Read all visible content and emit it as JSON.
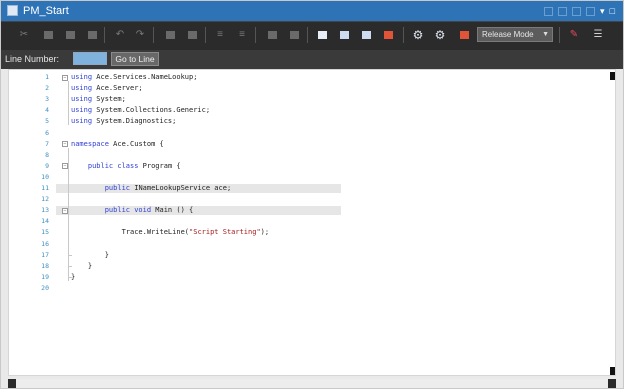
{
  "window": {
    "title": "PM_Start"
  },
  "toolbar": {
    "build_mode": "Release Mode"
  },
  "line_bar": {
    "label": "Line Number:",
    "input_value": "",
    "go_label": "Go to Line"
  },
  "editor": {
    "line_numbers": [
      "1",
      "2",
      "3",
      "4",
      "5",
      "6",
      "7",
      "8",
      "9",
      "10",
      "11",
      "12",
      "13",
      "14",
      "15",
      "16",
      "17",
      "18",
      "19",
      "20"
    ],
    "lines": [
      {
        "pre": "",
        "kw": "using",
        "post": " Ace.Services.NameLookup;"
      },
      {
        "pre": "",
        "kw": "using",
        "post": " Ace.Server;"
      },
      {
        "pre": "",
        "kw": "using",
        "post": " System;"
      },
      {
        "pre": "",
        "kw": "using",
        "post": " System.Collections.Generic;"
      },
      {
        "pre": "",
        "kw": "using",
        "post": " System.Diagnostics;"
      },
      {
        "pre": "",
        "kw": "",
        "post": ""
      },
      {
        "pre": "",
        "kw": "namespace",
        "post": " Ace.Custom {"
      },
      {
        "pre": "",
        "kw": "",
        "post": ""
      },
      {
        "pre": "    ",
        "kw": "public class",
        "post": " Program {"
      },
      {
        "pre": "",
        "kw": "",
        "post": ""
      },
      {
        "pre": "        ",
        "kw": "public",
        "post": " INameLookupService ace;"
      },
      {
        "pre": "",
        "kw": "",
        "post": ""
      },
      {
        "pre": "        ",
        "kw": "public void",
        "post": " Main () {"
      },
      {
        "pre": "",
        "kw": "",
        "post": ""
      },
      {
        "pre": "            Trace.WriteLine(",
        "kw": "",
        "post": ");",
        "str": "\"Script Starting\""
      },
      {
        "pre": "",
        "kw": "",
        "post": ""
      },
      {
        "pre": "        }",
        "kw": "",
        "post": ""
      },
      {
        "pre": "    }",
        "kw": "",
        "post": ""
      },
      {
        "pre": "}",
        "kw": "",
        "post": ""
      },
      {
        "pre": "",
        "kw": "",
        "post": ""
      }
    ]
  }
}
